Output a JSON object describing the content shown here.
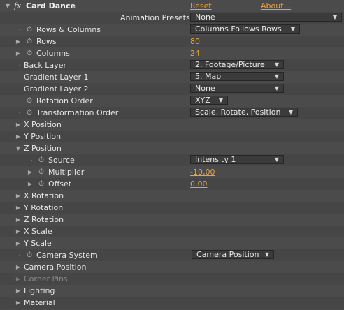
{
  "effect": {
    "fx_label": "fx",
    "name": "Card Dance",
    "reset_label": "Reset",
    "about_label": "About..."
  },
  "animation_presets": {
    "label": "Animation Presets:",
    "value": "None"
  },
  "rows_columns": {
    "label": "Rows & Columns",
    "value": "Columns Follows Rows"
  },
  "rows": {
    "label": "Rows",
    "value": "80"
  },
  "columns": {
    "label": "Columns",
    "value": "24"
  },
  "back_layer": {
    "label": "Back Layer",
    "value": "2. Footage/Picture"
  },
  "gradient_layer_1": {
    "label": "Gradient Layer 1",
    "value": "5. Map"
  },
  "gradient_layer_2": {
    "label": "Gradient Layer 2",
    "value": "None"
  },
  "rotation_order": {
    "label": "Rotation Order",
    "value": "XYZ"
  },
  "transformation_order": {
    "label": "Transformation Order",
    "value": "Scale, Rotate, Position"
  },
  "x_position": {
    "label": "X Position"
  },
  "y_position": {
    "label": "Y Position"
  },
  "z_position": {
    "label": "Z Position",
    "source": {
      "label": "Source",
      "value": "Intensity 1"
    },
    "multiplier": {
      "label": "Multiplier",
      "value": "-10,00"
    },
    "offset": {
      "label": "Offset",
      "value": "0,00"
    }
  },
  "x_rotation": {
    "label": "X Rotation"
  },
  "y_rotation": {
    "label": "Y Rotation"
  },
  "z_rotation": {
    "label": "Z Rotation"
  },
  "x_scale": {
    "label": "X Scale"
  },
  "y_scale": {
    "label": "Y Scale"
  },
  "camera_system": {
    "label": "Camera System",
    "value": "Camera Position"
  },
  "camera_position": {
    "label": "Camera Position"
  },
  "corner_pins": {
    "label": "Corner Pins"
  },
  "lighting": {
    "label": "Lighting"
  },
  "material": {
    "label": "Material"
  },
  "glyphs": {
    "twirl_open": "▼",
    "twirl_closed": "▶",
    "stopwatch": "⏱",
    "dropdown_arrow": "▼"
  }
}
